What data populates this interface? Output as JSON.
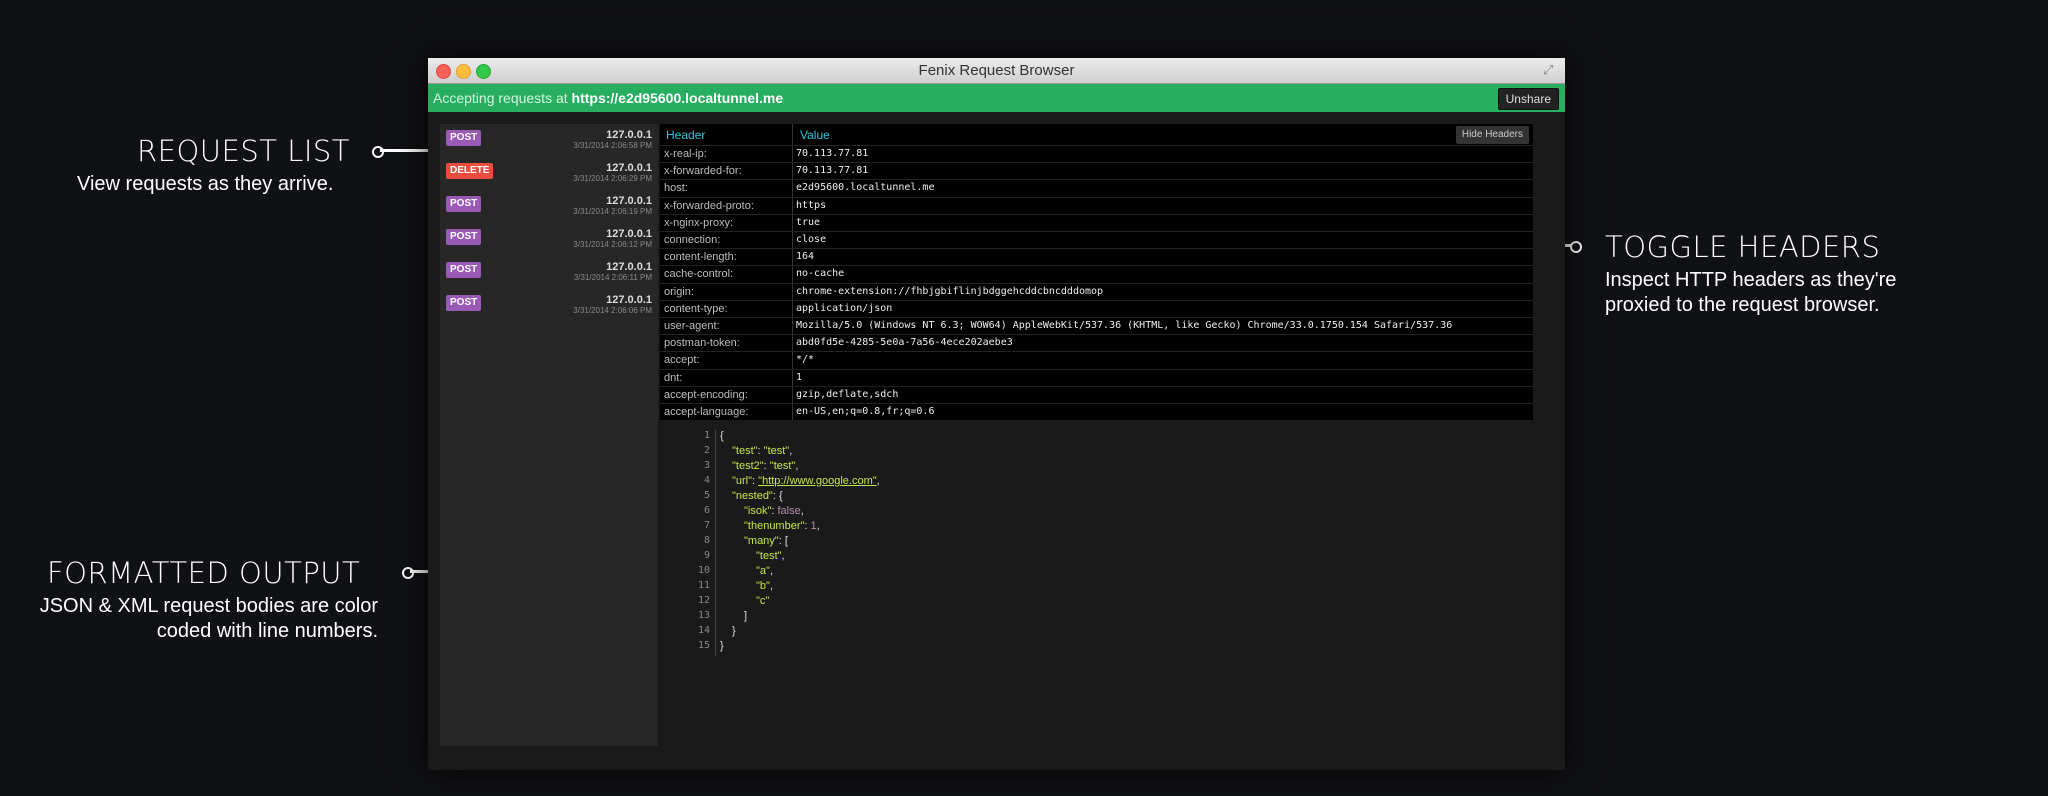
{
  "annotations": {
    "request_list": {
      "title": "REQUEST LIST",
      "desc": "View requests as they arrive."
    },
    "toggle_headers": {
      "title": "TOGGLE HEADERS",
      "desc1": "Inspect HTTP headers as they're",
      "desc2": "proxied to the request browser."
    },
    "formatted_output": {
      "title": "FORMATTED OUTPUT",
      "desc1": "JSON & XML request bodies are color",
      "desc2": "coded with line numbers."
    }
  },
  "window": {
    "title": "Fenix Request Browser",
    "share_prefix": "Accepting requests at ",
    "share_url": "https://e2d95600.localtunnel.me",
    "unshare_label": "Unshare"
  },
  "requests": [
    {
      "method": "POST",
      "ip": "127.0.0.1",
      "time": "3/31/2014 2:06:58 PM"
    },
    {
      "method": "DELETE",
      "ip": "127.0.0.1",
      "time": "3/31/2014 2:06:29 PM"
    },
    {
      "method": "POST",
      "ip": "127.0.0.1",
      "time": "3/31/2014 2:06:19 PM"
    },
    {
      "method": "POST",
      "ip": "127.0.0.1",
      "time": "3/31/2014 2:06:12 PM"
    },
    {
      "method": "POST",
      "ip": "127.0.0.1",
      "time": "3/31/2014 2:06:11 PM"
    },
    {
      "method": "POST",
      "ip": "127.0.0.1",
      "time": "3/31/2014 2:06:06 PM"
    }
  ],
  "headers_table": {
    "col_header": "Header",
    "col_value": "Value",
    "hide_label": "Hide Headers",
    "rows": [
      {
        "k": "x-real-ip:",
        "v": "70.113.77.81"
      },
      {
        "k": "x-forwarded-for:",
        "v": "70.113.77.81"
      },
      {
        "k": "host:",
        "v": "e2d95600.localtunnel.me"
      },
      {
        "k": "x-forwarded-proto:",
        "v": "https"
      },
      {
        "k": "x-nginx-proxy:",
        "v": "true"
      },
      {
        "k": "connection:",
        "v": "close"
      },
      {
        "k": "content-length:",
        "v": "164"
      },
      {
        "k": "cache-control:",
        "v": "no-cache"
      },
      {
        "k": "origin:",
        "v": "chrome-extension://fhbjgbiflinjbdggehcddcbncdddomop"
      },
      {
        "k": "content-type:",
        "v": "application/json"
      },
      {
        "k": "user-agent:",
        "v": "Mozilla/5.0 (Windows NT 6.3; WOW64) AppleWebKit/537.36 (KHTML, like Gecko) Chrome/33.0.1750.154 Safari/537.36"
      },
      {
        "k": "postman-token:",
        "v": "abd0fd5e-4285-5e0a-7a56-4ece202aebe3"
      },
      {
        "k": "accept:",
        "v": "*/*"
      },
      {
        "k": "dnt:",
        "v": "1"
      },
      {
        "k": "accept-encoding:",
        "v": "gzip,deflate,sdch"
      },
      {
        "k": "accept-language:",
        "v": "en-US,en;q=0.8,fr;q=0.6"
      }
    ]
  },
  "code": {
    "line_numbers": [
      "1",
      "2",
      "3",
      "4",
      "5",
      "6",
      "7",
      "8",
      "9",
      "10",
      "11",
      "12",
      "13",
      "14",
      "15"
    ],
    "lines": {
      "l1": "{",
      "l2k": "\"test\"",
      "l2v": "\"test\"",
      "l3k": "\"test2\"",
      "l3v": "\"test\"",
      "l4k": "\"url\"",
      "l4v": "\"http://www.google.com\"",
      "l5k": "\"nested\"",
      "l5p": ": {",
      "l6k": "\"isok\"",
      "l6v": "false",
      "l7k": "\"thenumber\"",
      "l7v": "1",
      "l8k": "\"many\"",
      "l8p": ": [",
      "l9": "\"test\"",
      "l10": "\"a\"",
      "l11": "\"b\"",
      "l12": "\"c\"",
      "l13": "]",
      "l14": "}",
      "l15": "}"
    }
  }
}
